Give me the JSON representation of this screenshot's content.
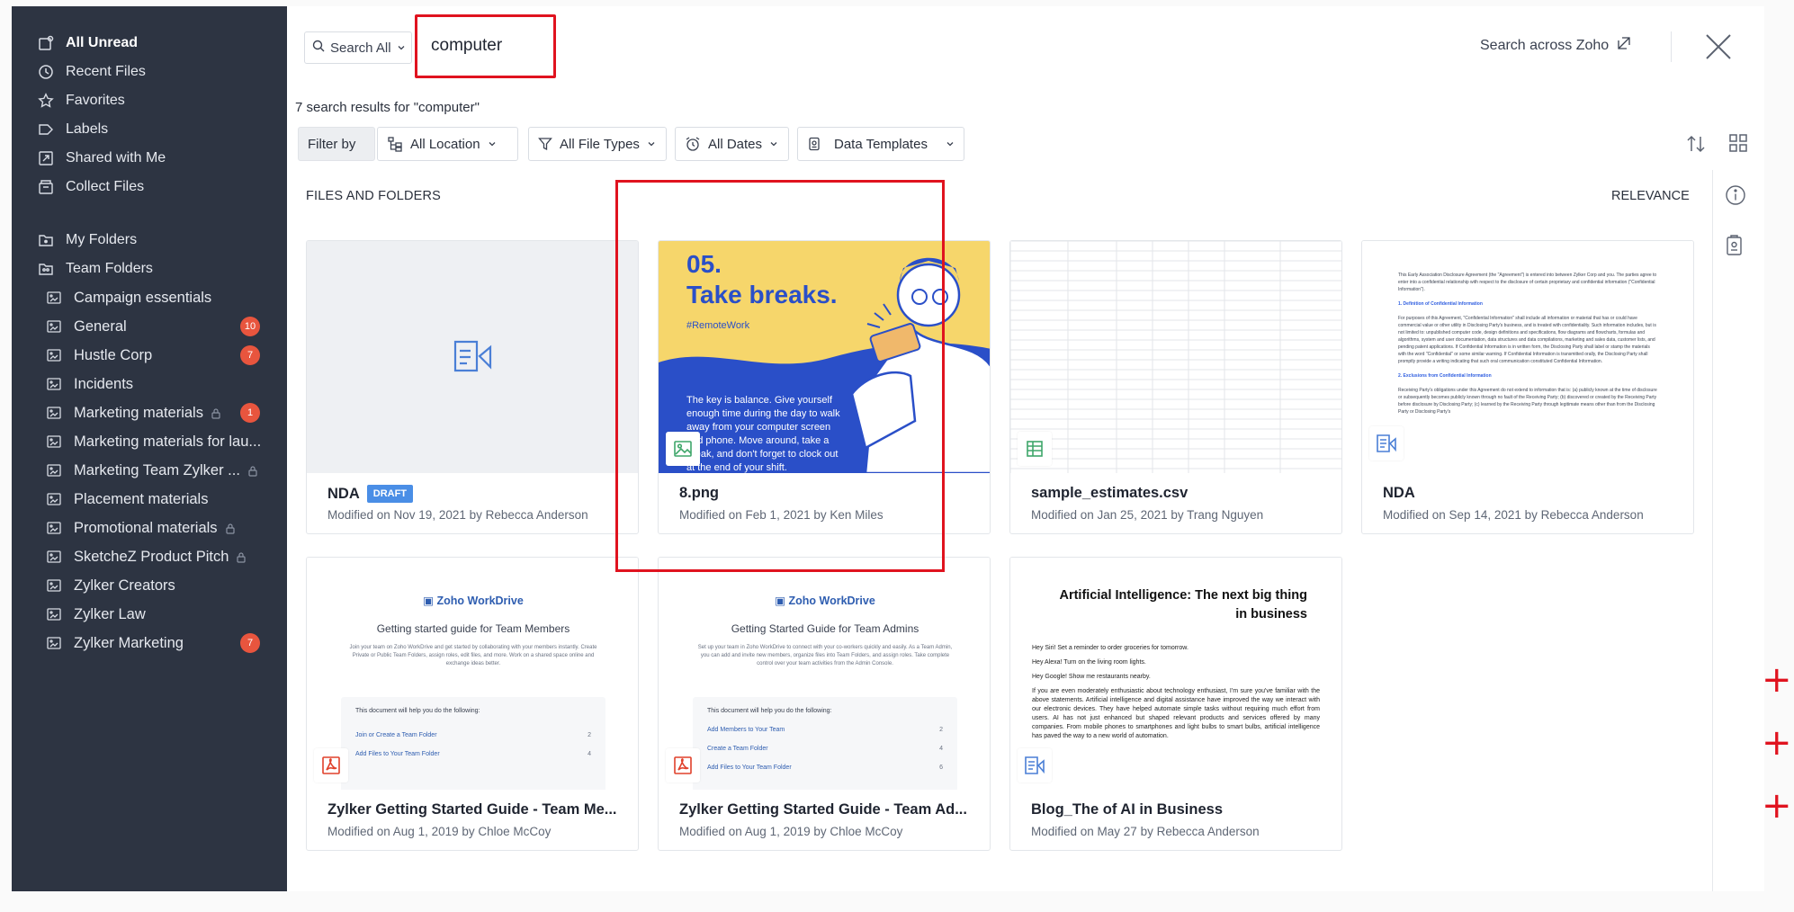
{
  "sidebar": {
    "top_items": [
      {
        "label": "All Unread",
        "icon": "unread-icon"
      },
      {
        "label": "Recent Files",
        "icon": "clock-icon"
      },
      {
        "label": "Favorites",
        "icon": "star-icon"
      },
      {
        "label": "Labels",
        "icon": "label-icon"
      },
      {
        "label": "Shared with Me",
        "icon": "shared-icon"
      },
      {
        "label": "Collect Files",
        "icon": "collect-icon"
      }
    ],
    "my_folders": "My Folders",
    "team_folders": "Team Folders",
    "folders": [
      {
        "label": "Campaign essentials"
      },
      {
        "label": "General",
        "badge": "10"
      },
      {
        "label": "Hustle Corp",
        "badge": "7"
      },
      {
        "label": "Incidents"
      },
      {
        "label": "Marketing materials",
        "badge": "1",
        "locked": true
      },
      {
        "label": "Marketing materials for lau..."
      },
      {
        "label": "Marketing Team Zylker ...",
        "locked": true
      },
      {
        "label": "Placement materials"
      },
      {
        "label": "Promotional materials",
        "locked": true
      },
      {
        "label": "SketcheZ Product Pitch",
        "locked": true
      },
      {
        "label": "Zylker Creators"
      },
      {
        "label": "Zylker Law"
      },
      {
        "label": "Zylker Marketing",
        "badge": "7"
      }
    ]
  },
  "search": {
    "scope": "Search All",
    "query": "computer",
    "across_label": "Search across Zoho",
    "result_count": "7 search results for \"computer\""
  },
  "filters": {
    "filter_by": "Filter by",
    "location": "All Location",
    "file_types": "All File Types",
    "dates": "All Dates",
    "templates": "Data Templates"
  },
  "section": {
    "title": "FILES AND FOLDERS",
    "sort": "RELEVANCE"
  },
  "files": [
    {
      "name": "NDA",
      "badge": "DRAFT",
      "meta": "Modified on Nov 19, 2021 by Rebecca Anderson",
      "type": "writer"
    },
    {
      "name": "8.png",
      "meta": "Modified on Feb 1, 2021 by Ken Miles",
      "type": "image"
    },
    {
      "name": "sample_estimates.csv",
      "meta": "Modified on Jan 25, 2021 by Trang Nguyen",
      "type": "sheet"
    },
    {
      "name": "NDA",
      "meta": "Modified on Sep 14, 2021 by Rebecca Anderson",
      "type": "writer"
    },
    {
      "name": "Zylker Getting Started Guide - Team Me...",
      "meta": "Modified on Aug 1, 2019 by Chloe McCoy",
      "type": "pdf"
    },
    {
      "name": "Zylker Getting Started Guide - Team Ad...",
      "meta": "Modified on Aug 1, 2019 by Chloe McCoy",
      "type": "pdf"
    },
    {
      "name": "Blog_The of AI in Business",
      "meta": "Modified on May 27 by Rebecca Anderson",
      "type": "writer"
    }
  ],
  "thumbs": {
    "poster": {
      "number": "05.",
      "headline": "Take breaks.",
      "tag": "#RemoteWork",
      "body": "The key is balance. Give yourself enough time during the day to walk away from your computer screen and phone. Move around, take a break, and don't forget to clock out at the end of your shift."
    },
    "nda_preview": {
      "p1": "This Early Association Disclosure Agreement (the \"Agreement\") is entered into between Zylker Corp and you. The parties agree to enter into a confidential relationship with respect to the disclosure of certain proprietary and confidential information (\"Confidential Information\").",
      "h1": "1. Definition of Confidential Information",
      "p2": "For purposes of this Agreement, \"Confidential Information\" shall include all information or material that has or could have commercial value or other utility in Disclosing Party's business, and is treated with confidentiality. Such information includes, but is not limited to: unpublished computer code, design definitions and specifications, flow diagrams and flowcharts, formulas and algorithms, system and user documentation, data structures and data compilations, marketing and sales data, customer lists, and pending patent applications. If Confidential Information is in written form, the Disclosing Party shall label or stamp the materials with the word \"Confidential\" or some similar warning. If Confidential Information is transmitted orally, the Disclosing Party shall promptly provide a writing indicating that such oral communication constituted Confidential Information.",
      "h2": "2. Exclusions from Confidential Information",
      "p3": "Receiving Party's obligations under this Agreement do not extend to information that is: (a) publicly known at the time of disclosure or subsequently becomes publicly known through no fault of the Receiving Party; (b) discovered or created by the Receiving Party before disclosure by Disclosing Party; (c) learned by the Receiving Party through legitimate means other than from the Disclosing Party or Disclosing Party's"
    },
    "guide_members": {
      "brand": "Zoho WorkDrive",
      "subtitle": "Getting started guide for Team Members",
      "para": "Join your team on Zoho WorkDrive and get started by collaborating with your members instantly. Create Private or Public Team Folders, assign roles, edit files, and more. Work on a shared space online and exchange ideas better.",
      "box_title": "This document will help you do the following:",
      "rows": [
        {
          "label": "Join or Create a Team Folder",
          "n": "2"
        },
        {
          "label": "Add Files to Your Team Folder",
          "n": "4"
        }
      ]
    },
    "guide_admins": {
      "brand": "Zoho WorkDrive",
      "subtitle": "Getting Started Guide for Team Admins",
      "para": "Set up your team in Zoho WorkDrive to connect with your co-workers quickly and easily. As a Team Admin, you can add and invite new members, organize files into Team Folders, and assign roles. Take complete control over your team activities from the Admin Console.",
      "box_title": "This document will help you do the following:",
      "rows": [
        {
          "label": "Add Members to Your Team",
          "n": "2"
        },
        {
          "label": "Create a Team Folder",
          "n": "4"
        },
        {
          "label": "Add Files to Your Team Folder",
          "n": "6"
        }
      ]
    },
    "blog": {
      "title": "Artificial Intelligence: The next big thing in business",
      "l1": "Hey Siri! Set a reminder to order groceries for tomorrow.",
      "l2": "Hey Alexa! Turn on the living room lights.",
      "l3": "Hey Google! Show me restaurants nearby.",
      "para": "If you are even moderately enthusiastic about technology enthusiast, I'm sure you've familiar with the above statements. Artificial intelligence and digital assistance have improved the way we interact with our electronic devices. They have helped automate simple tasks without requiring much effort from users. AI has not just enhanced but shaped relevant products and services offered by many companies. From mobile phones to smartphones and light bulbs to smart bulbs, artificial intelligence has paved the way to a new world of automation."
    }
  },
  "colors": {
    "sidebar_bg": "#2d3442",
    "badge": "#e8553e",
    "draft": "#4a8ee6",
    "highlight": "#e0131f",
    "poster_yellow": "#f6d66b",
    "poster_blue": "#2a4fc8"
  }
}
